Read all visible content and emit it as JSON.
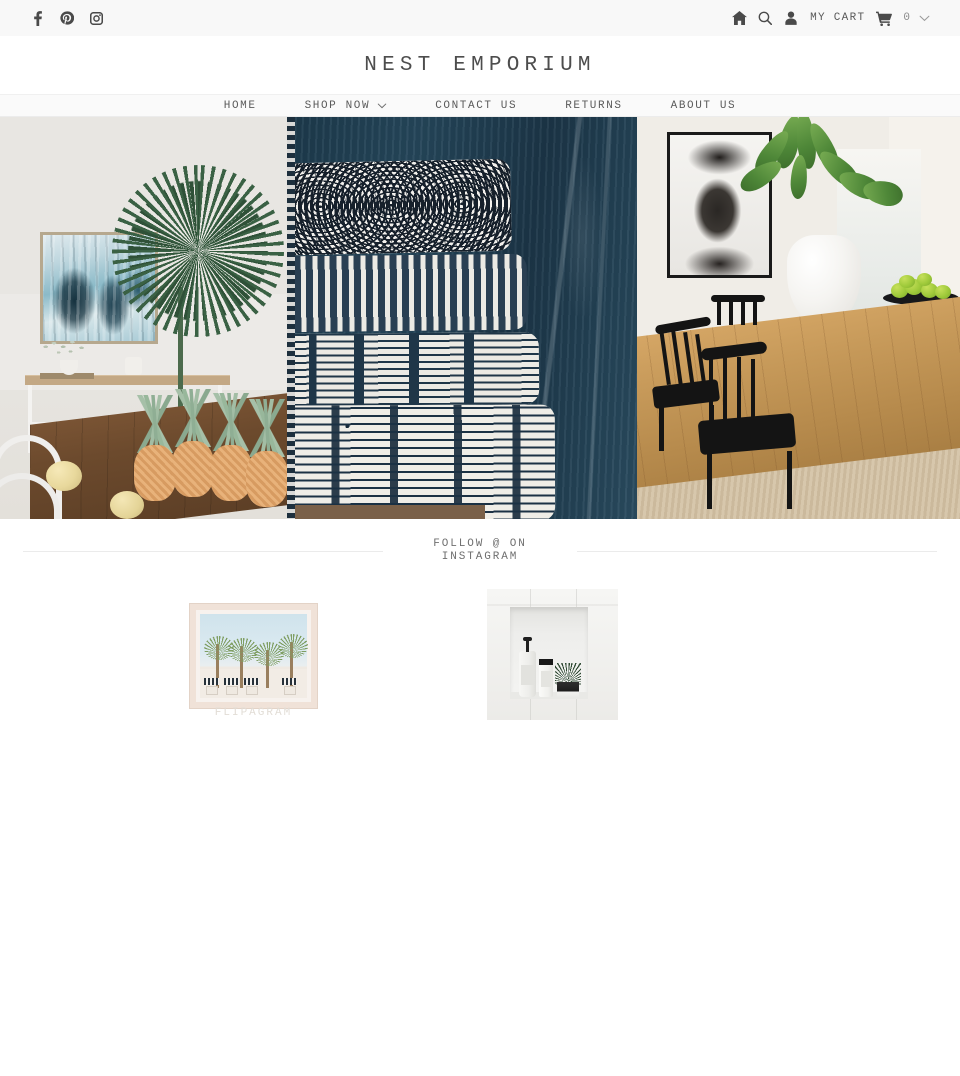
{
  "topbar": {
    "social": [
      {
        "name": "facebook-icon",
        "label": "Facebook"
      },
      {
        "name": "pinterest-icon",
        "label": "Pinterest"
      },
      {
        "name": "instagram-icon",
        "label": "Instagram"
      }
    ],
    "utility": {
      "home_icon": "home-icon",
      "search_icon": "search-icon",
      "account_icon": "user-icon",
      "cart_label": "MY CART",
      "cart_icon": "shopping-cart-icon",
      "cart_count": "0",
      "chevron": "chevron-down-icon"
    }
  },
  "brand": {
    "title": "NEST EMPORIUM"
  },
  "nav": {
    "items": [
      {
        "label": "HOME",
        "has_dropdown": false
      },
      {
        "label": "SHOP NOW",
        "has_dropdown": true
      },
      {
        "label": "CONTACT US",
        "has_dropdown": false
      },
      {
        "label": "RETURNS",
        "has_dropdown": false
      },
      {
        "label": "ABOUT US",
        "has_dropdown": false
      }
    ]
  },
  "hero": {
    "slides": [
      {
        "alt": "Coastal dining room with abstract blue artwork, palm frond and pineapples on a rustic wood table"
      },
      {
        "alt": "Stack of indigo block-print cushions against a dark blue painted wood wall"
      },
      {
        "alt": "Dining room with black spindle chairs, white vase, framed portrait and bowl of green fruit"
      }
    ]
  },
  "instagram": {
    "heading_line1": "FOLLOW @ ON",
    "heading_line2": "INSTAGRAM",
    "posts": [
      {
        "alt": "Framed art print of palm trees in front of a white building",
        "watermark": "FLIPAGRAM"
      },
      {
        "alt": "Bathroom niche with soap bottles and a small potted succulent",
        "watermark": ""
      }
    ]
  },
  "colors": {
    "topbar_bg": "#f8f8f8",
    "nav_bg": "#fafafa",
    "page_bg": "#ffffff",
    "text": "#5b5b5b",
    "rule": "#ebebeb"
  }
}
